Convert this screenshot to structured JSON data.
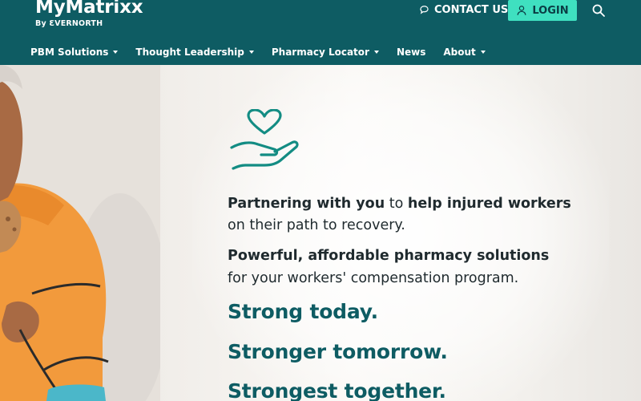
{
  "header": {
    "logo_name": "MyMatrixx",
    "logo_by": "By ƐVERNORTH",
    "contact_label": "CONTACT US",
    "login_label": "LOGIN",
    "colors": {
      "bar": "#0e5c63",
      "login_bg": "#3fe0c0"
    }
  },
  "nav": {
    "items": [
      {
        "label": "PBM Solutions",
        "dropdown": true
      },
      {
        "label": "Thought Leadership",
        "dropdown": true
      },
      {
        "label": "Pharmacy Locator",
        "dropdown": true
      },
      {
        "label": "News",
        "dropdown": false
      },
      {
        "label": "About",
        "dropdown": true
      }
    ]
  },
  "hero": {
    "icon": "hand-heart-icon",
    "line1_bold1": "Partnering with you",
    "line1_normal": " to ",
    "line1_bold2": "help injured workers",
    "line2": "on their path to recovery.",
    "line3_bold": "Powerful, affordable pharmacy solutions",
    "line4": "for your workers' compensation program.",
    "tagline1": "Strong today.",
    "tagline2": "Stronger tomorrow.",
    "tagline3": "Strongest together.",
    "accent": "#0e5c63"
  }
}
